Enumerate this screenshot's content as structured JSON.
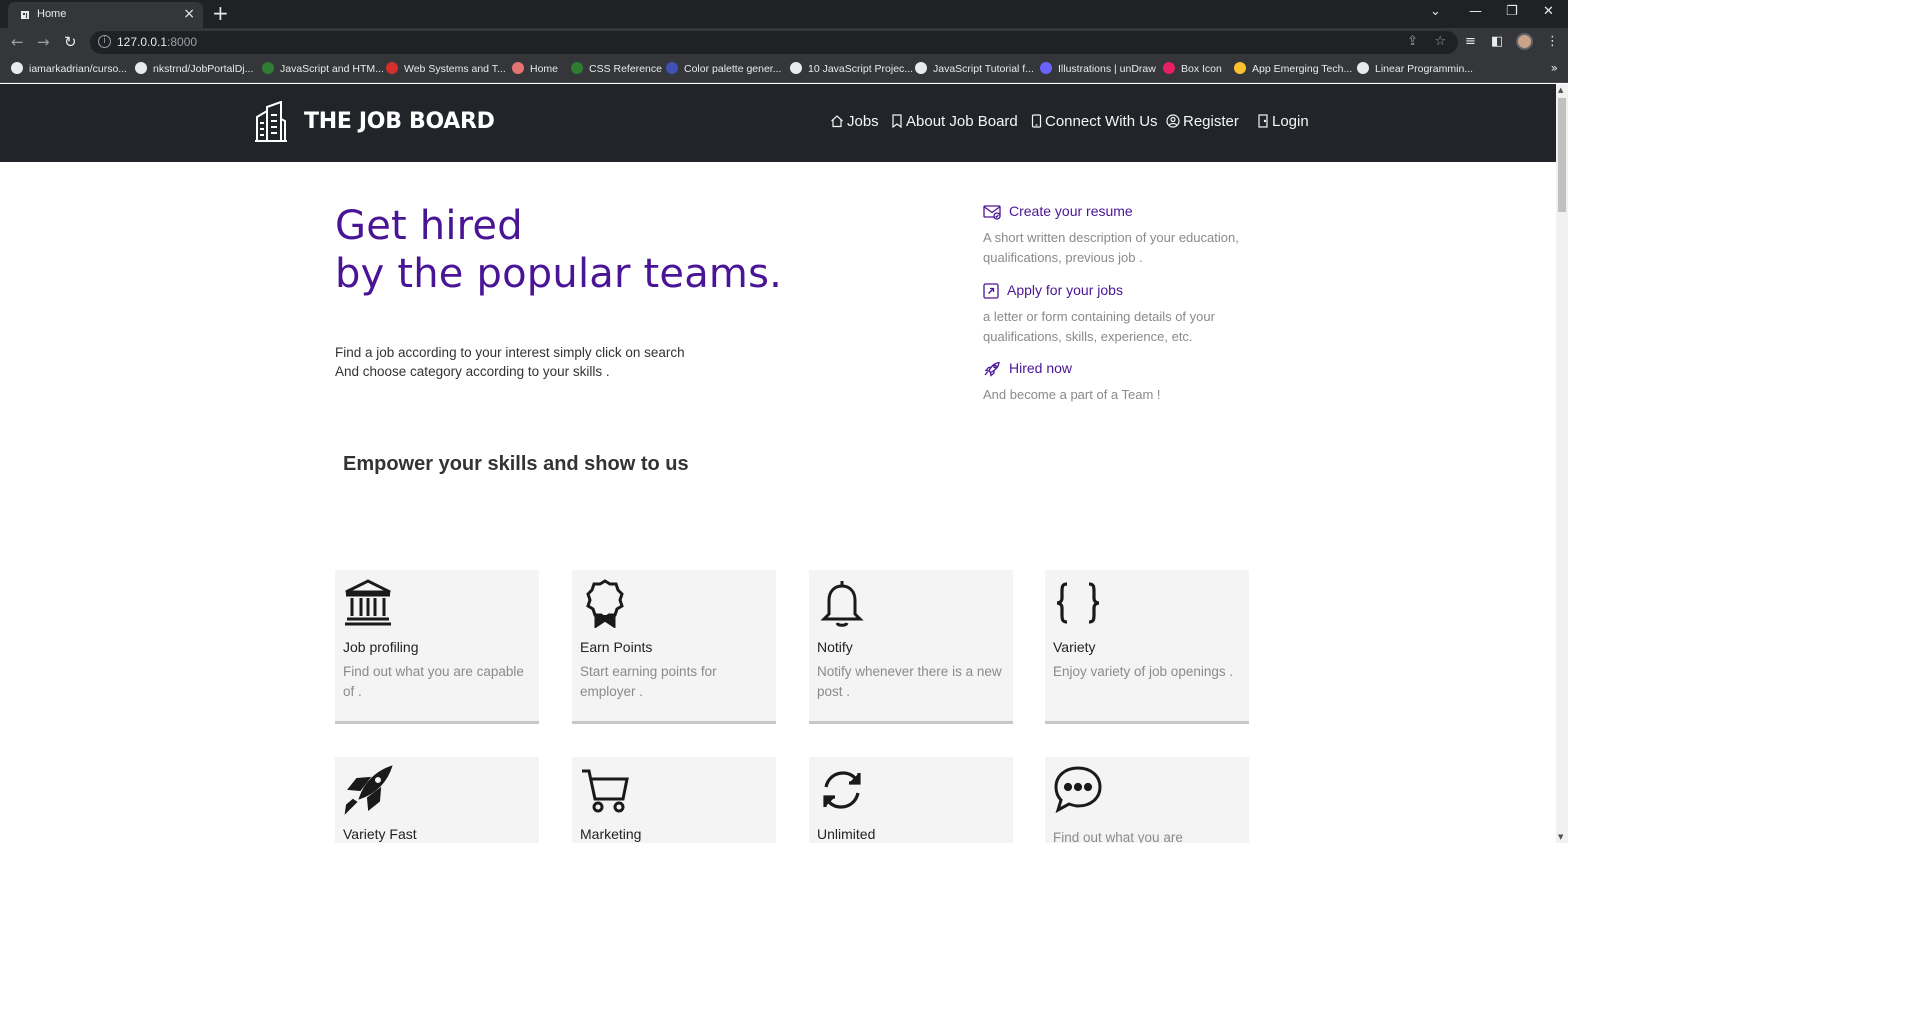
{
  "browser": {
    "tab_title": "Home",
    "url_host": "127.0.0.1",
    "url_port": ":8000",
    "bookmarks": [
      {
        "label": "iamarkadrian/curso...",
        "color": "#e8eaed"
      },
      {
        "label": "nkstrnd/JobPortalDj...",
        "color": "#e8eaed"
      },
      {
        "label": "JavaScript and HTM...",
        "color": "#2e7d32"
      },
      {
        "label": "Web Systems and T...",
        "color": "#d32f2f"
      },
      {
        "label": "Home",
        "color": "#e57373"
      },
      {
        "label": "CSS Reference",
        "color": "#2e7d32"
      },
      {
        "label": "Color palette gener...",
        "color": "#3f51b5"
      },
      {
        "label": "10 JavaScript Projec...",
        "color": "#e8eaed"
      },
      {
        "label": "JavaScript Tutorial f...",
        "color": "#e8eaed"
      },
      {
        "label": "Illustrations | unDraw",
        "color": "#6c63ff"
      },
      {
        "label": "Box Icon",
        "color": "#e91e63"
      },
      {
        "label": "App Emerging Tech...",
        "color": "#fbc02d"
      },
      {
        "label": "Linear Programmin...",
        "color": "#e8eaed"
      }
    ]
  },
  "navbar": {
    "brand": "THE JOB BOARD",
    "links": [
      {
        "label": "Jobs",
        "icon": "home-icon"
      },
      {
        "label": "About Job Board",
        "icon": "bookmark-icon"
      },
      {
        "label": "Connect With Us",
        "icon": "phone-icon"
      },
      {
        "label": "Register",
        "icon": "user-circle-icon"
      },
      {
        "label": "Login",
        "icon": "door-icon"
      }
    ]
  },
  "hero": {
    "title_line1": "Get hired",
    "title_line2": "by the popular teams.",
    "desc_line1": "Find a job according to your interest simply click on search",
    "desc_line2": "And choose category according to your skills ."
  },
  "features": [
    {
      "title": "Create your resume",
      "desc": "A short written description of your education, qualifications, previous job .",
      "icon": "envelope-icon"
    },
    {
      "title": "Apply for your jobs",
      "desc": "a letter or form containing details of your qualifications, skills, experience, etc.",
      "icon": "external-link-icon"
    },
    {
      "title": "Hired now",
      "desc": "And become a part of a Team !",
      "icon": "rocket-icon"
    }
  ],
  "section_title": "Empower your skills and show to us",
  "cards": [
    {
      "title": "Job profiling",
      "desc": "Find out what you are capable of .",
      "icon": "bank-icon"
    },
    {
      "title": "Earn Points",
      "desc": "Start earning points for employer .",
      "icon": "award-icon"
    },
    {
      "title": "Notify",
      "desc": "Notify whenever there is a new post .",
      "icon": "bell-icon"
    },
    {
      "title": "Variety",
      "desc": "Enjoy variety of job openings .",
      "icon": "braces-icon"
    },
    {
      "title": "Variety Fast",
      "desc": "",
      "icon": "rocket-icon"
    },
    {
      "title": "Marketing",
      "desc": "",
      "icon": "cart-icon"
    },
    {
      "title": "Unlimited",
      "desc": "",
      "icon": "refresh-icon"
    },
    {
      "title": "",
      "desc": "Find out what you are",
      "icon": "chat-icon"
    }
  ]
}
